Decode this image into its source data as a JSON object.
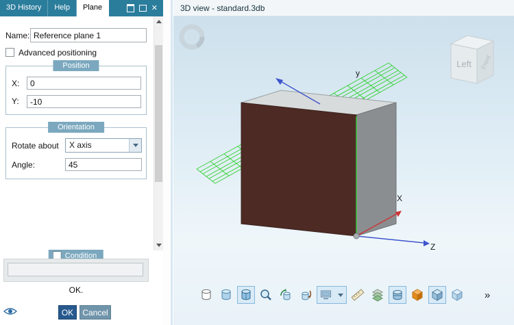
{
  "tab_bar": {
    "tabs": [
      {
        "label": "3D History"
      },
      {
        "label": "Help"
      },
      {
        "label": "Plane"
      }
    ],
    "close_glyph": "✕"
  },
  "form": {
    "name_label": "Name:",
    "name_value": "Reference plane 1",
    "advanced_positioning_label": "Advanced positioning",
    "position": {
      "title": "Position",
      "x_label": "X:",
      "x_value": "0",
      "y_label": "Y:",
      "y_value": "-10"
    },
    "orientation": {
      "title": "Orientation",
      "rotate_about_label": "Rotate about",
      "rotate_about_value": "X axis",
      "angle_label": "Angle:",
      "angle_value": "45"
    },
    "condition": {
      "title": "Condition",
      "value": ""
    },
    "status_text": "OK.",
    "ok_label": "OK",
    "cancel_label": "Cancel"
  },
  "viewport": {
    "title": "3D view - standard.3db",
    "axes": {
      "x": "X",
      "y": "y",
      "z": "Z"
    },
    "nav_cube": {
      "left": "Left",
      "front": "Front"
    }
  },
  "toolbar": {
    "items": [
      {
        "name": "cylinder-wireframe-icon",
        "selected": false
      },
      {
        "name": "cylinder-shaded-icon",
        "selected": false
      },
      {
        "name": "cylinder-shaded-edges-icon",
        "selected": true
      },
      {
        "name": "zoom-icon",
        "selected": false
      },
      {
        "name": "cylinder-rotate-icon",
        "selected": false
      },
      {
        "name": "cylinder-turntable-icon",
        "selected": false
      },
      {
        "name": "view-preset-combo",
        "selected": true
      },
      {
        "name": "ruler-icon",
        "selected": false
      },
      {
        "name": "mesh-layers-icon",
        "selected": false
      },
      {
        "name": "cylinder-section-icon",
        "selected": true
      },
      {
        "name": "orange-cube-icon",
        "selected": false
      },
      {
        "name": "blue-cube-framed-icon",
        "selected": true
      },
      {
        "name": "blue-cube-icon",
        "selected": false
      }
    ],
    "overflow_glyph": "»"
  },
  "colors": {
    "accent_teal": "#2b7d9c",
    "group_header": "#7ba8be",
    "ok_button": "#27598e",
    "cancel_button": "#7095ab",
    "plane_green": "#32d232",
    "cube_face": "#4e2a25",
    "axis_blue": "#3f55cc",
    "axis_red": "#cc3333"
  }
}
